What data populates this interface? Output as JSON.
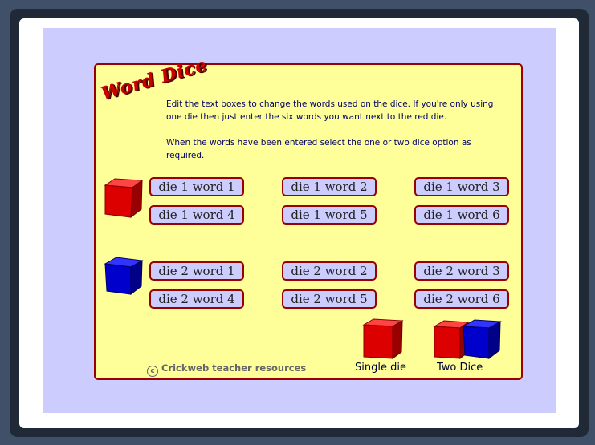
{
  "app": {
    "title": "Word Dice"
  },
  "instructions": {
    "line1": "Edit the text boxes to change the words used on the dice. If you're only using one die then just enter the six words you want next to the red die.",
    "line2": "When the words have been entered select the one or two dice option as required."
  },
  "die1": {
    "color": "#dd0000",
    "words": [
      "die 1 word 1",
      "die 1 word 2",
      "die 1 word 3",
      "die 1 word 4",
      "die 1 word 5",
      "die 1 word 6"
    ]
  },
  "die2": {
    "color": "#0000cc",
    "words": [
      "die 2 word 1",
      "die 2 word 2",
      "die 2 word 3",
      "die 2 word 4",
      "die 2 word 5",
      "die 2 word 6"
    ]
  },
  "options": {
    "single_label": "Single die",
    "two_label": "Two Dice"
  },
  "footer": {
    "copyright_symbol": "c",
    "credit": "Crickweb teacher resources"
  },
  "colors": {
    "panel": "#ffff99",
    "border": "#990000",
    "stage": "#ccccff",
    "text": "#000066"
  }
}
